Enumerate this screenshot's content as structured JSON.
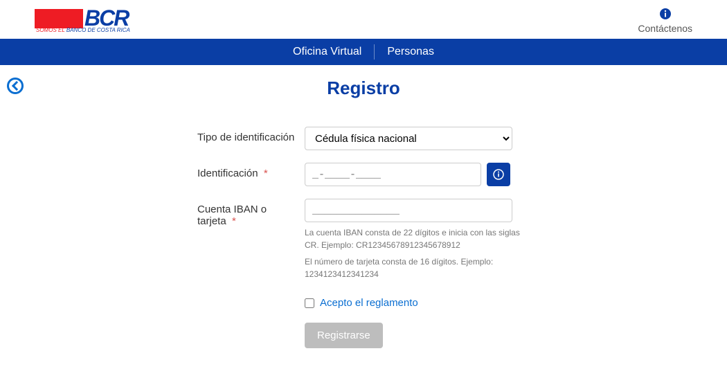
{
  "header": {
    "logo_text": "BCR",
    "logo_tagline_prefix": "SOMOS EL",
    "logo_tagline_suffix": " BANCO DE COSTA RICA",
    "contact_label": "Contáctenos"
  },
  "nav": {
    "oficina_label": "Oficina Virtual",
    "personas_label": "Personas"
  },
  "page": {
    "title": "Registro"
  },
  "form": {
    "tipo_label": "Tipo de identificación",
    "tipo_value": "Cédula física nacional",
    "id_label": "Identificación",
    "id_placeholder": "_-____-____",
    "iban_label": "Cuenta IBAN o tarjeta",
    "iban_placeholder": "______________",
    "helper_iban": "La cuenta IBAN consta de 22 dígitos e inicia con las siglas CR. Ejemplo: CR12345678912345678912",
    "helper_card": "El número de tarjeta consta de 16 dígitos. Ejemplo: 1234123412341234",
    "accept_label": "Acepto el reglamento",
    "submit_label": "Registrarse",
    "required_mark": "*"
  }
}
